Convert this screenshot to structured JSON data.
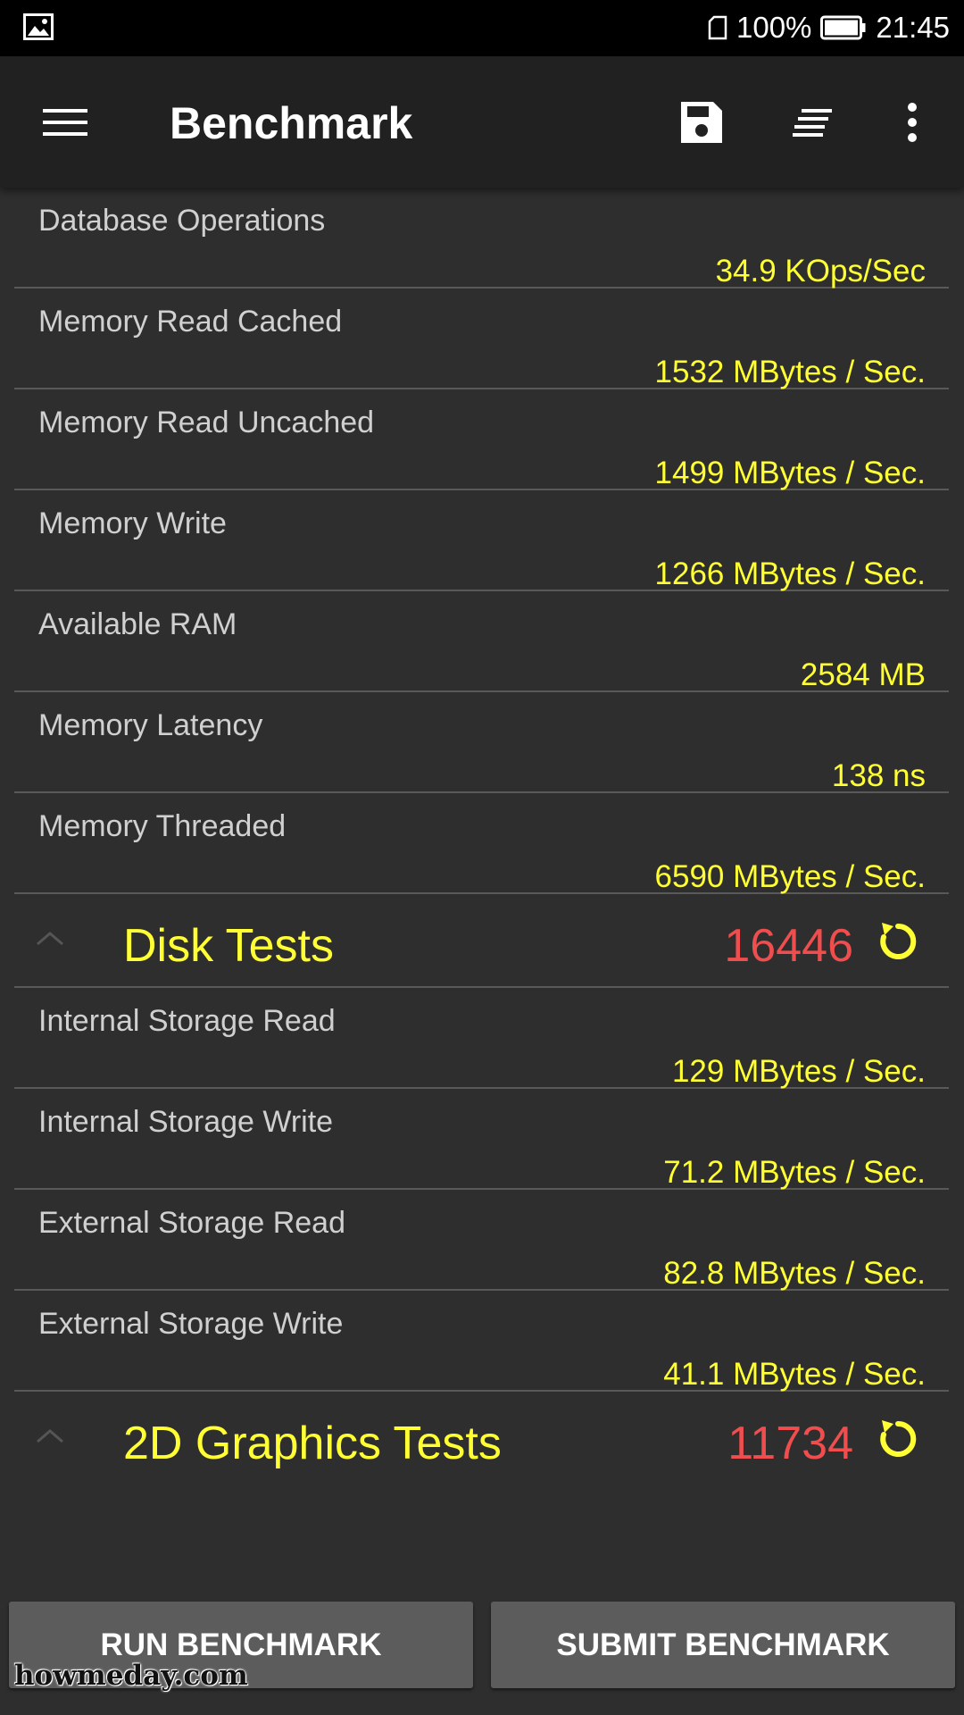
{
  "status_bar": {
    "battery_percent": "100%",
    "time": "21:45"
  },
  "app_bar": {
    "title": "Benchmark"
  },
  "colors": {
    "value_yellow": "#ffff33",
    "score_red": "#f04e4e",
    "background": "#2e2e2e"
  },
  "memory_results": [
    {
      "label": "Database Operations",
      "value": "34.9 KOps/Sec"
    },
    {
      "label": "Memory Read Cached",
      "value": "1532 MBytes / Sec."
    },
    {
      "label": "Memory Read Uncached",
      "value": "1499 MBytes / Sec."
    },
    {
      "label": "Memory Write",
      "value": "1266 MBytes / Sec."
    },
    {
      "label": "Available RAM",
      "value": "2584 MB"
    },
    {
      "label": "Memory Latency",
      "value": "138 ns"
    },
    {
      "label": "Memory Threaded",
      "value": "6590 MBytes / Sec."
    }
  ],
  "disk_section": {
    "title": "Disk Tests",
    "score": "16446"
  },
  "disk_results": [
    {
      "label": "Internal Storage Read",
      "value": "129 MBytes / Sec."
    },
    {
      "label": "Internal Storage Write",
      "value": "71.2 MBytes / Sec."
    },
    {
      "label": "External Storage Read",
      "value": "82.8 MBytes / Sec."
    },
    {
      "label": "External Storage Write",
      "value": "41.1 MBytes / Sec."
    }
  ],
  "graphics_section": {
    "title": "2D Graphics Tests",
    "score": "11734"
  },
  "buttons": {
    "run": "RUN BENCHMARK",
    "submit": "SUBMIT BENCHMARK"
  },
  "watermark": "howmeday.com"
}
